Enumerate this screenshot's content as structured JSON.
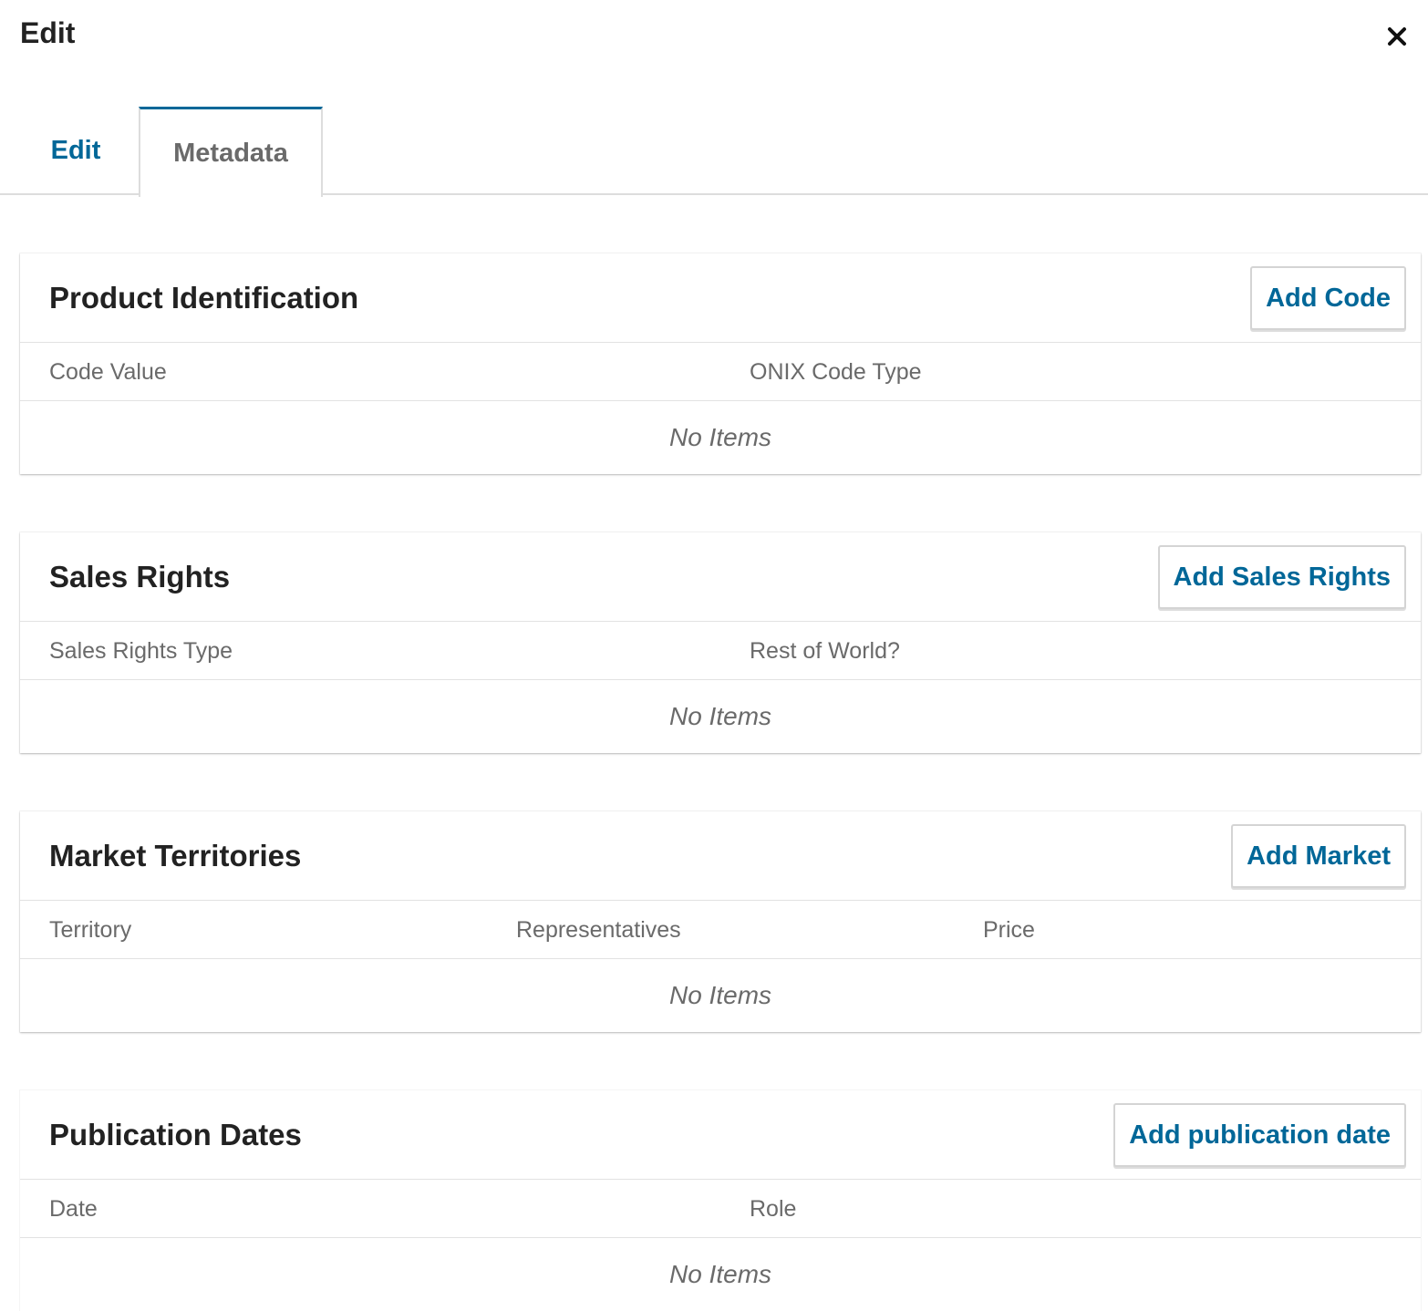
{
  "modal": {
    "title": "Edit",
    "close_icon": "close-icon"
  },
  "tabs": [
    {
      "label": "Edit",
      "active": false
    },
    {
      "label": "Metadata",
      "active": true
    }
  ],
  "panels": [
    {
      "title": "Product Identification",
      "button": "Add Code",
      "columns": [
        "Code Value",
        "ONIX Code Type"
      ],
      "empty": "No Items"
    },
    {
      "title": "Sales Rights",
      "button": "Add Sales Rights",
      "columns": [
        "Sales Rights Type",
        "Rest of World?"
      ],
      "empty": "No Items"
    },
    {
      "title": "Market Territories",
      "button": "Add Market",
      "columns": [
        "Territory",
        "Representatives",
        "Price"
      ],
      "empty": "No Items"
    },
    {
      "title": "Publication Dates",
      "button": "Add publication date",
      "columns": [
        "Date",
        "Role"
      ],
      "empty": "No Items"
    }
  ],
  "colors": {
    "accent": "#006798",
    "muted_text": "#6a6a6a",
    "border": "#dddddd"
  }
}
